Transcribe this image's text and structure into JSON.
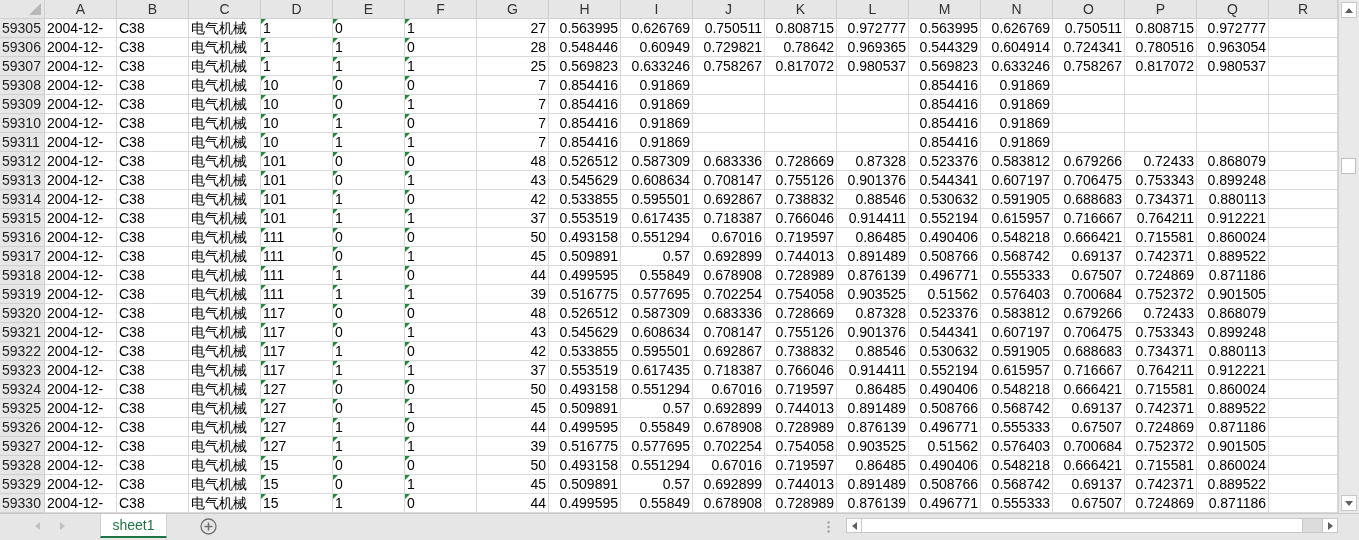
{
  "columns": [
    {
      "label": "A",
      "kind": "text",
      "text_flag": false
    },
    {
      "label": "B",
      "kind": "text",
      "text_flag": false
    },
    {
      "label": "C",
      "kind": "text",
      "text_flag": false
    },
    {
      "label": "D",
      "kind": "text",
      "text_flag": true
    },
    {
      "label": "E",
      "kind": "text",
      "text_flag": true
    },
    {
      "label": "F",
      "kind": "text",
      "text_flag": true
    },
    {
      "label": "G",
      "kind": "number",
      "text_flag": false
    },
    {
      "label": "H",
      "kind": "number",
      "text_flag": false
    },
    {
      "label": "I",
      "kind": "number",
      "text_flag": false
    },
    {
      "label": "J",
      "kind": "number",
      "text_flag": false
    },
    {
      "label": "K",
      "kind": "number",
      "text_flag": false
    },
    {
      "label": "L",
      "kind": "number",
      "text_flag": false
    },
    {
      "label": "M",
      "kind": "number",
      "text_flag": false
    },
    {
      "label": "N",
      "kind": "number",
      "text_flag": false
    },
    {
      "label": "O",
      "kind": "number",
      "text_flag": false
    },
    {
      "label": "P",
      "kind": "number",
      "text_flag": false
    },
    {
      "label": "Q",
      "kind": "number",
      "text_flag": false
    },
    {
      "label": "R",
      "text_flag": false
    }
  ],
  "rows": [
    {
      "number": "59305",
      "cells": [
        "2004-12-",
        "C38",
        "电气机械",
        "1",
        "0",
        "1",
        "27",
        "0.563995",
        "0.626769",
        "0.750511",
        "0.808715",
        "0.972777",
        "0.563995",
        "0.626769",
        "0.750511",
        "0.808715",
        "0.972777",
        null
      ]
    },
    {
      "number": "59306",
      "cells": [
        "2004-12-",
        "C38",
        "电气机械",
        "1",
        "1",
        "0",
        "28",
        "0.548446",
        "0.60949",
        "0.729821",
        "0.78642",
        "0.969365",
        "0.544329",
        "0.604914",
        "0.724341",
        "0.780516",
        "0.963054",
        null
      ]
    },
    {
      "number": "59307",
      "cells": [
        "2004-12-",
        "C38",
        "电气机械",
        "1",
        "1",
        "1",
        "25",
        "0.569823",
        "0.633246",
        "0.758267",
        "0.817072",
        "0.980537",
        "0.569823",
        "0.633246",
        "0.758267",
        "0.817072",
        "0.980537",
        null
      ]
    },
    {
      "number": "59308",
      "cells": [
        "2004-12-",
        "C38",
        "电气机械",
        "10",
        "0",
        "0",
        "7",
        "0.854416",
        "0.91869",
        null,
        null,
        null,
        "0.854416",
        "0.91869",
        null,
        null,
        null,
        null
      ]
    },
    {
      "number": "59309",
      "cells": [
        "2004-12-",
        "C38",
        "电气机械",
        "10",
        "0",
        "1",
        "7",
        "0.854416",
        "0.91869",
        null,
        null,
        null,
        "0.854416",
        "0.91869",
        null,
        null,
        null,
        null
      ]
    },
    {
      "number": "59310",
      "cells": [
        "2004-12-",
        "C38",
        "电气机械",
        "10",
        "1",
        "0",
        "7",
        "0.854416",
        "0.91869",
        null,
        null,
        null,
        "0.854416",
        "0.91869",
        null,
        null,
        null,
        null
      ]
    },
    {
      "number": "59311",
      "cells": [
        "2004-12-",
        "C38",
        "电气机械",
        "10",
        "1",
        "1",
        "7",
        "0.854416",
        "0.91869",
        null,
        null,
        null,
        "0.854416",
        "0.91869",
        null,
        null,
        null,
        null
      ]
    },
    {
      "number": "59312",
      "cells": [
        "2004-12-",
        "C38",
        "电气机械",
        "101",
        "0",
        "0",
        "48",
        "0.526512",
        "0.587309",
        "0.683336",
        "0.728669",
        "0.87328",
        "0.523376",
        "0.583812",
        "0.679266",
        "0.72433",
        "0.868079",
        null
      ]
    },
    {
      "number": "59313",
      "cells": [
        "2004-12-",
        "C38",
        "电气机械",
        "101",
        "0",
        "1",
        "43",
        "0.545629",
        "0.608634",
        "0.708147",
        "0.755126",
        "0.901376",
        "0.544341",
        "0.607197",
        "0.706475",
        "0.753343",
        "0.899248",
        null
      ]
    },
    {
      "number": "59314",
      "cells": [
        "2004-12-",
        "C38",
        "电气机械",
        "101",
        "1",
        "0",
        "42",
        "0.533855",
        "0.595501",
        "0.692867",
        "0.738832",
        "0.88546",
        "0.530632",
        "0.591905",
        "0.688683",
        "0.734371",
        "0.880113",
        null
      ]
    },
    {
      "number": "59315",
      "cells": [
        "2004-12-",
        "C38",
        "电气机械",
        "101",
        "1",
        "1",
        "37",
        "0.553519",
        "0.617435",
        "0.718387",
        "0.766046",
        "0.914411",
        "0.552194",
        "0.615957",
        "0.716667",
        "0.764211",
        "0.912221",
        null
      ]
    },
    {
      "number": "59316",
      "cells": [
        "2004-12-",
        "C38",
        "电气机械",
        "111",
        "0",
        "0",
        "50",
        "0.493158",
        "0.551294",
        "0.67016",
        "0.719597",
        "0.86485",
        "0.490406",
        "0.548218",
        "0.666421",
        "0.715581",
        "0.860024",
        null
      ]
    },
    {
      "number": "59317",
      "cells": [
        "2004-12-",
        "C38",
        "电气机械",
        "111",
        "0",
        "1",
        "45",
        "0.509891",
        "0.57",
        "0.692899",
        "0.744013",
        "0.891489",
        "0.508766",
        "0.568742",
        "0.69137",
        "0.742371",
        "0.889522",
        null
      ]
    },
    {
      "number": "59318",
      "cells": [
        "2004-12-",
        "C38",
        "电气机械",
        "111",
        "1",
        "0",
        "44",
        "0.499595",
        "0.55849",
        "0.678908",
        "0.728989",
        "0.876139",
        "0.496771",
        "0.555333",
        "0.67507",
        "0.724869",
        "0.871186",
        null
      ]
    },
    {
      "number": "59319",
      "cells": [
        "2004-12-",
        "C38",
        "电气机械",
        "111",
        "1",
        "1",
        "39",
        "0.516775",
        "0.577695",
        "0.702254",
        "0.754058",
        "0.903525",
        "0.51562",
        "0.576403",
        "0.700684",
        "0.752372",
        "0.901505",
        null
      ]
    },
    {
      "number": "59320",
      "cells": [
        "2004-12-",
        "C38",
        "电气机械",
        "117",
        "0",
        "0",
        "48",
        "0.526512",
        "0.587309",
        "0.683336",
        "0.728669",
        "0.87328",
        "0.523376",
        "0.583812",
        "0.679266",
        "0.72433",
        "0.868079",
        null
      ]
    },
    {
      "number": "59321",
      "cells": [
        "2004-12-",
        "C38",
        "电气机械",
        "117",
        "0",
        "1",
        "43",
        "0.545629",
        "0.608634",
        "0.708147",
        "0.755126",
        "0.901376",
        "0.544341",
        "0.607197",
        "0.706475",
        "0.753343",
        "0.899248",
        null
      ]
    },
    {
      "number": "59322",
      "cells": [
        "2004-12-",
        "C38",
        "电气机械",
        "117",
        "1",
        "0",
        "42",
        "0.533855",
        "0.595501",
        "0.692867",
        "0.738832",
        "0.88546",
        "0.530632",
        "0.591905",
        "0.688683",
        "0.734371",
        "0.880113",
        null
      ]
    },
    {
      "number": "59323",
      "cells": [
        "2004-12-",
        "C38",
        "电气机械",
        "117",
        "1",
        "1",
        "37",
        "0.553519",
        "0.617435",
        "0.718387",
        "0.766046",
        "0.914411",
        "0.552194",
        "0.615957",
        "0.716667",
        "0.764211",
        "0.912221",
        null
      ]
    },
    {
      "number": "59324",
      "cells": [
        "2004-12-",
        "C38",
        "电气机械",
        "127",
        "0",
        "0",
        "50",
        "0.493158",
        "0.551294",
        "0.67016",
        "0.719597",
        "0.86485",
        "0.490406",
        "0.548218",
        "0.666421",
        "0.715581",
        "0.860024",
        null
      ]
    },
    {
      "number": "59325",
      "cells": [
        "2004-12-",
        "C38",
        "电气机械",
        "127",
        "0",
        "1",
        "45",
        "0.509891",
        "0.57",
        "0.692899",
        "0.744013",
        "0.891489",
        "0.508766",
        "0.568742",
        "0.69137",
        "0.742371",
        "0.889522",
        null
      ]
    },
    {
      "number": "59326",
      "cells": [
        "2004-12-",
        "C38",
        "电气机械",
        "127",
        "1",
        "0",
        "44",
        "0.499595",
        "0.55849",
        "0.678908",
        "0.728989",
        "0.876139",
        "0.496771",
        "0.555333",
        "0.67507",
        "0.724869",
        "0.871186",
        null
      ]
    },
    {
      "number": "59327",
      "cells": [
        "2004-12-",
        "C38",
        "电气机械",
        "127",
        "1",
        "1",
        "39",
        "0.516775",
        "0.577695",
        "0.702254",
        "0.754058",
        "0.903525",
        "0.51562",
        "0.576403",
        "0.700684",
        "0.752372",
        "0.901505",
        null
      ]
    },
    {
      "number": "59328",
      "cells": [
        "2004-12-",
        "C38",
        "电气机械",
        "15",
        "0",
        "0",
        "50",
        "0.493158",
        "0.551294",
        "0.67016",
        "0.719597",
        "0.86485",
        "0.490406",
        "0.548218",
        "0.666421",
        "0.715581",
        "0.860024",
        null
      ]
    },
    {
      "number": "59329",
      "cells": [
        "2004-12-",
        "C38",
        "电气机械",
        "15",
        "0",
        "1",
        "45",
        "0.509891",
        "0.57",
        "0.692899",
        "0.744013",
        "0.891489",
        "0.508766",
        "0.568742",
        "0.69137",
        "0.742371",
        "0.889522",
        null
      ]
    },
    {
      "number": "59330",
      "cells": [
        "2004-12-",
        "C38",
        "电气机械",
        "15",
        "1",
        "0",
        "44",
        "0.499595",
        "0.55849",
        "0.678908",
        "0.728989",
        "0.876139",
        "0.496771",
        "0.555333",
        "0.67507",
        "0.724869",
        "0.871186",
        null
      ]
    }
  ],
  "sheet_tabs": [
    {
      "label": "sheet1",
      "selected": true
    }
  ]
}
